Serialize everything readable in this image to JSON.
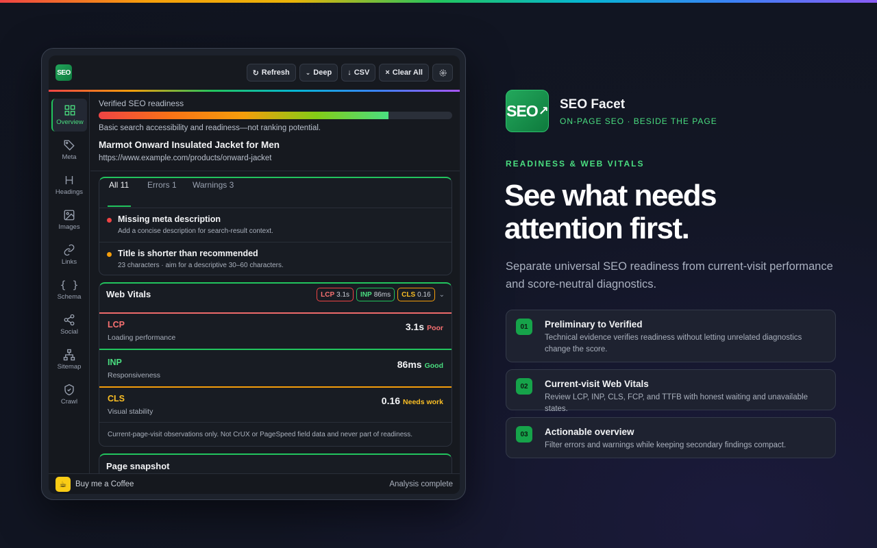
{
  "panel": {
    "logo_text": "SEO",
    "toolbar": {
      "refresh": "Refresh",
      "deep": "Deep",
      "csv": "CSV",
      "clear": "Clear All"
    },
    "nav": [
      {
        "label": "Overview",
        "icon": "grid-icon"
      },
      {
        "label": "Meta",
        "icon": "tag-icon"
      },
      {
        "label": "Headings",
        "icon": "heading-icon"
      },
      {
        "label": "Images",
        "icon": "image-icon"
      },
      {
        "label": "Links",
        "icon": "link-icon"
      },
      {
        "label": "Schema",
        "icon": "braces-icon"
      },
      {
        "label": "Social",
        "icon": "share-icon"
      },
      {
        "label": "Sitemap",
        "icon": "sitemap-icon"
      },
      {
        "label": "Crawl",
        "icon": "shield-icon"
      }
    ],
    "readiness": {
      "label": "Verified SEO readiness",
      "fill_fraction": 0.82,
      "note": "Basic search accessibility and readiness—not ranking potential."
    },
    "page": {
      "title": "Marmot Onward Insulated Jacket for Men",
      "url": "https://www.example.com/products/onward-jacket"
    },
    "issues": {
      "tabs": [
        "All 11",
        "Errors 1",
        "Warnings 3"
      ],
      "items": [
        {
          "title": "Missing meta description",
          "desc": "Add a concise description for search-result context.",
          "severity": "error",
          "color": "#ef4444"
        },
        {
          "title": "Title is shorter than recommended",
          "desc": "23 characters · aim for a descriptive 30–60 characters.",
          "severity": "warning",
          "color": "#f59e0b"
        }
      ]
    },
    "vitals": {
      "title": "Web Vitals",
      "chips": [
        {
          "name": "LCP",
          "value": "3.1s"
        },
        {
          "name": "INP",
          "value": "86ms"
        },
        {
          "name": "CLS",
          "value": "0.16"
        }
      ],
      "rows": [
        {
          "name": "LCP",
          "sub": "Loading performance",
          "value": "3.1s",
          "rating": "Poor",
          "color": "#f87171"
        },
        {
          "name": "INP",
          "sub": "Responsiveness",
          "value": "86ms",
          "rating": "Good",
          "color": "#4ade80"
        },
        {
          "name": "CLS",
          "sub": "Visual stability",
          "value": "0.16",
          "rating": "Needs work",
          "color": "#fbbf24"
        }
      ],
      "footnote": "Current-page-visit observations only. Not CrUX or PageSpeed field data and never part of readiness."
    },
    "snapshot_title": "Page snapshot",
    "footer": {
      "coffee": "Buy me a Coffee",
      "status": "Analysis complete"
    }
  },
  "hero": {
    "logo_text": "SEO",
    "brand_name": "SEO Facet",
    "brand_tag": "ON-PAGE SEO · BESIDE THE PAGE",
    "eyebrow": "READINESS & WEB VITALS",
    "headline": "See what needs attention first.",
    "lead": "Separate universal SEO readiness from current-visit performance and score-neutral diagnostics.",
    "accent": "#4ade80",
    "features": [
      {
        "num": "01",
        "title": "Preliminary to Verified",
        "desc": "Technical evidence verifies readiness without letting unrelated diagnostics change the score."
      },
      {
        "num": "02",
        "title": "Current-visit Web Vitals",
        "desc": "Review LCP, INP, CLS, FCP, and TTFB with honest waiting and unavailable states."
      },
      {
        "num": "03",
        "title": "Actionable overview",
        "desc": "Filter errors and warnings while keeping secondary findings compact."
      }
    ]
  }
}
